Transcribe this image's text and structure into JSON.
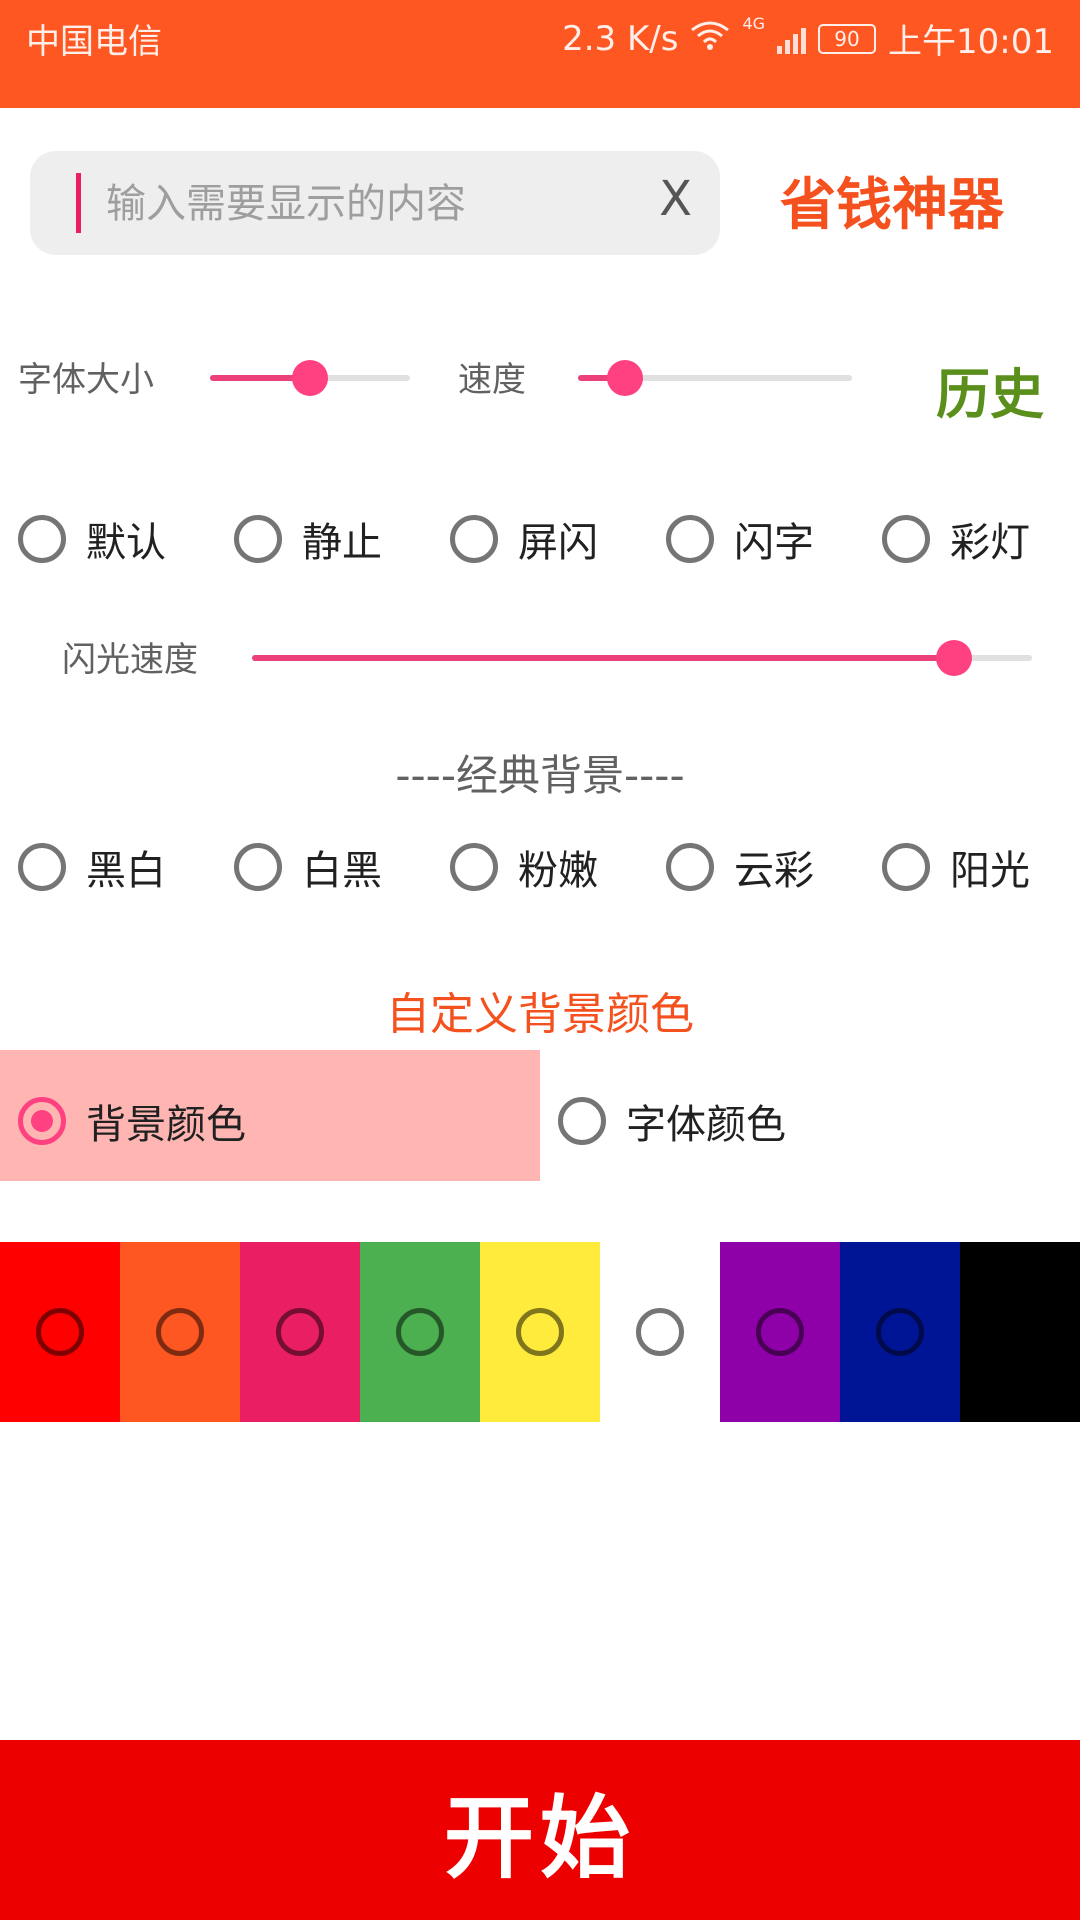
{
  "status_bar": {
    "carrier": "中国电信",
    "speed": "2.3 K/s",
    "network": "4G",
    "battery": "90",
    "time": "上午10:01"
  },
  "input": {
    "placeholder": "输入需要显示的内容",
    "clear_label": "X"
  },
  "brand": {
    "title": "省钱神器"
  },
  "sliders": {
    "font_size": {
      "label": "字体大小",
      "value": 0.5
    },
    "speed": {
      "label": "速度",
      "value": 0.17
    },
    "flash_speed": {
      "label": "闪光速度",
      "value": 0.9
    }
  },
  "history_label": "历史",
  "modes": [
    "默认",
    "静止",
    "屏闪",
    "闪字",
    "彩灯"
  ],
  "classic_backgrounds": {
    "title": "----经典背景----",
    "options": [
      "黑白",
      "白黑",
      "粉嫩",
      "云彩",
      "阳光"
    ]
  },
  "custom_background": {
    "title": "自定义背景颜色",
    "targets": [
      {
        "label": "背景颜色",
        "checked": true
      },
      {
        "label": "字体颜色",
        "checked": false
      }
    ]
  },
  "colors": [
    "#FF0000",
    "#FF5722",
    "#E91E63",
    "#4CAF50",
    "#FFEB3B",
    "#FFFFFF",
    "#8E00A8",
    "#001596",
    "#000000"
  ],
  "start_label": "开始"
}
